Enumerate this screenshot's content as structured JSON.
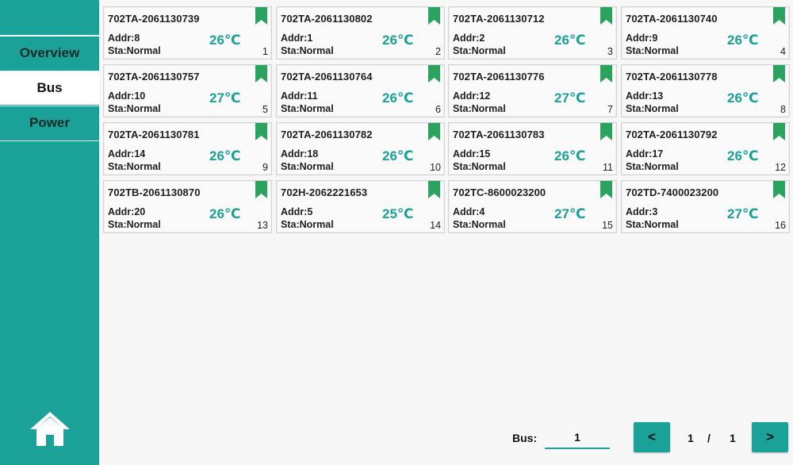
{
  "sidebar": {
    "items": [
      {
        "label": "Overview",
        "active": false
      },
      {
        "label": "Bus",
        "active": true
      },
      {
        "label": "Power",
        "active": false
      }
    ],
    "home_icon": "home-icon"
  },
  "colors": {
    "accent": "#1aa198",
    "bookmark": "#2aa35f"
  },
  "cards": [
    {
      "id": "702TA-2061130739",
      "addr": "Addr:8",
      "status": "Sta:Normal",
      "temp": "26℃",
      "index": "1"
    },
    {
      "id": "702TA-2061130802",
      "addr": "Addr:1",
      "status": "Sta:Normal",
      "temp": "26℃",
      "index": "2"
    },
    {
      "id": "702TA-2061130712",
      "addr": "Addr:2",
      "status": "Sta:Normal",
      "temp": "26℃",
      "index": "3"
    },
    {
      "id": "702TA-2061130740",
      "addr": "Addr:9",
      "status": "Sta:Normal",
      "temp": "26℃",
      "index": "4"
    },
    {
      "id": "702TA-2061130757",
      "addr": "Addr:10",
      "status": "Sta:Normal",
      "temp": "27℃",
      "index": "5"
    },
    {
      "id": "702TA-2061130764",
      "addr": "Addr:11",
      "status": "Sta:Normal",
      "temp": "26℃",
      "index": "6"
    },
    {
      "id": "702TA-2061130776",
      "addr": "Addr:12",
      "status": "Sta:Normal",
      "temp": "27℃",
      "index": "7"
    },
    {
      "id": "702TA-2061130778",
      "addr": "Addr:13",
      "status": "Sta:Normal",
      "temp": "26℃",
      "index": "8"
    },
    {
      "id": "702TA-2061130781",
      "addr": "Addr:14",
      "status": "Sta:Normal",
      "temp": "26℃",
      "index": "9"
    },
    {
      "id": "702TA-2061130782",
      "addr": "Addr:18",
      "status": "Sta:Normal",
      "temp": "26℃",
      "index": "10"
    },
    {
      "id": "702TA-2061130783",
      "addr": "Addr:15",
      "status": "Sta:Normal",
      "temp": "26℃",
      "index": "11"
    },
    {
      "id": "702TA-2061130792",
      "addr": "Addr:17",
      "status": "Sta:Normal",
      "temp": "26℃",
      "index": "12"
    },
    {
      "id": "702TB-2061130870",
      "addr": "Addr:20",
      "status": "Sta:Normal",
      "temp": "26℃",
      "index": "13"
    },
    {
      "id": "702H-2062221653",
      "addr": "Addr:5",
      "status": "Sta:Normal",
      "temp": "25℃",
      "index": "14"
    },
    {
      "id": "702TC-8600023200",
      "addr": "Addr:4",
      "status": "Sta:Normal",
      "temp": "27℃",
      "index": "15"
    },
    {
      "id": "702TD-7400023200",
      "addr": "Addr:3",
      "status": "Sta:Normal",
      "temp": "27℃",
      "index": "16"
    }
  ],
  "footer": {
    "bus_label": "Bus:",
    "bus_value": "1",
    "prev_label": "<",
    "next_label": ">",
    "current_page": "1",
    "separator": "/",
    "total_pages": "1"
  }
}
